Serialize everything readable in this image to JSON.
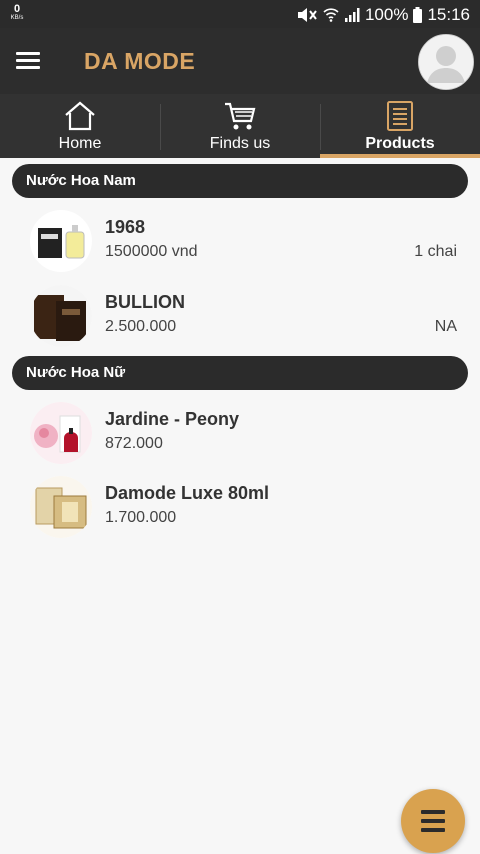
{
  "status_bar": {
    "speed_value": "0",
    "speed_unit": "KB/s",
    "battery_percent": "100%",
    "time": "15:16",
    "icons": [
      "mute-icon",
      "wifi-icon",
      "signal-icon",
      "battery-icon"
    ]
  },
  "app_bar": {
    "title": "DA MODE",
    "menu_icon": "hamburger-menu-icon",
    "avatar_icon": "user-avatar-icon",
    "accent_color": "#d9a565"
  },
  "tabs": [
    {
      "label": "Home",
      "icon": "home-icon",
      "active": false
    },
    {
      "label": "Finds us",
      "icon": "cart-icon",
      "active": false
    },
    {
      "label": "Products",
      "icon": "list-icon",
      "active": true
    }
  ],
  "sections": [
    {
      "title": "Nước Hoa Nam",
      "items": [
        {
          "name": "1968",
          "price": "1500000 vnd",
          "unit": "1 chai"
        },
        {
          "name": "BULLION",
          "price": "2.500.000",
          "unit": "NA"
        }
      ]
    },
    {
      "title": "Nước Hoa Nữ",
      "items": [
        {
          "name": "Jardine - Peony",
          "price": "872.000",
          "unit": ""
        },
        {
          "name": "Damode Luxe 80ml",
          "price": "1.700.000",
          "unit": ""
        }
      ]
    }
  ],
  "fab": {
    "icon": "menu-lines-icon",
    "color": "#d9a24f"
  }
}
